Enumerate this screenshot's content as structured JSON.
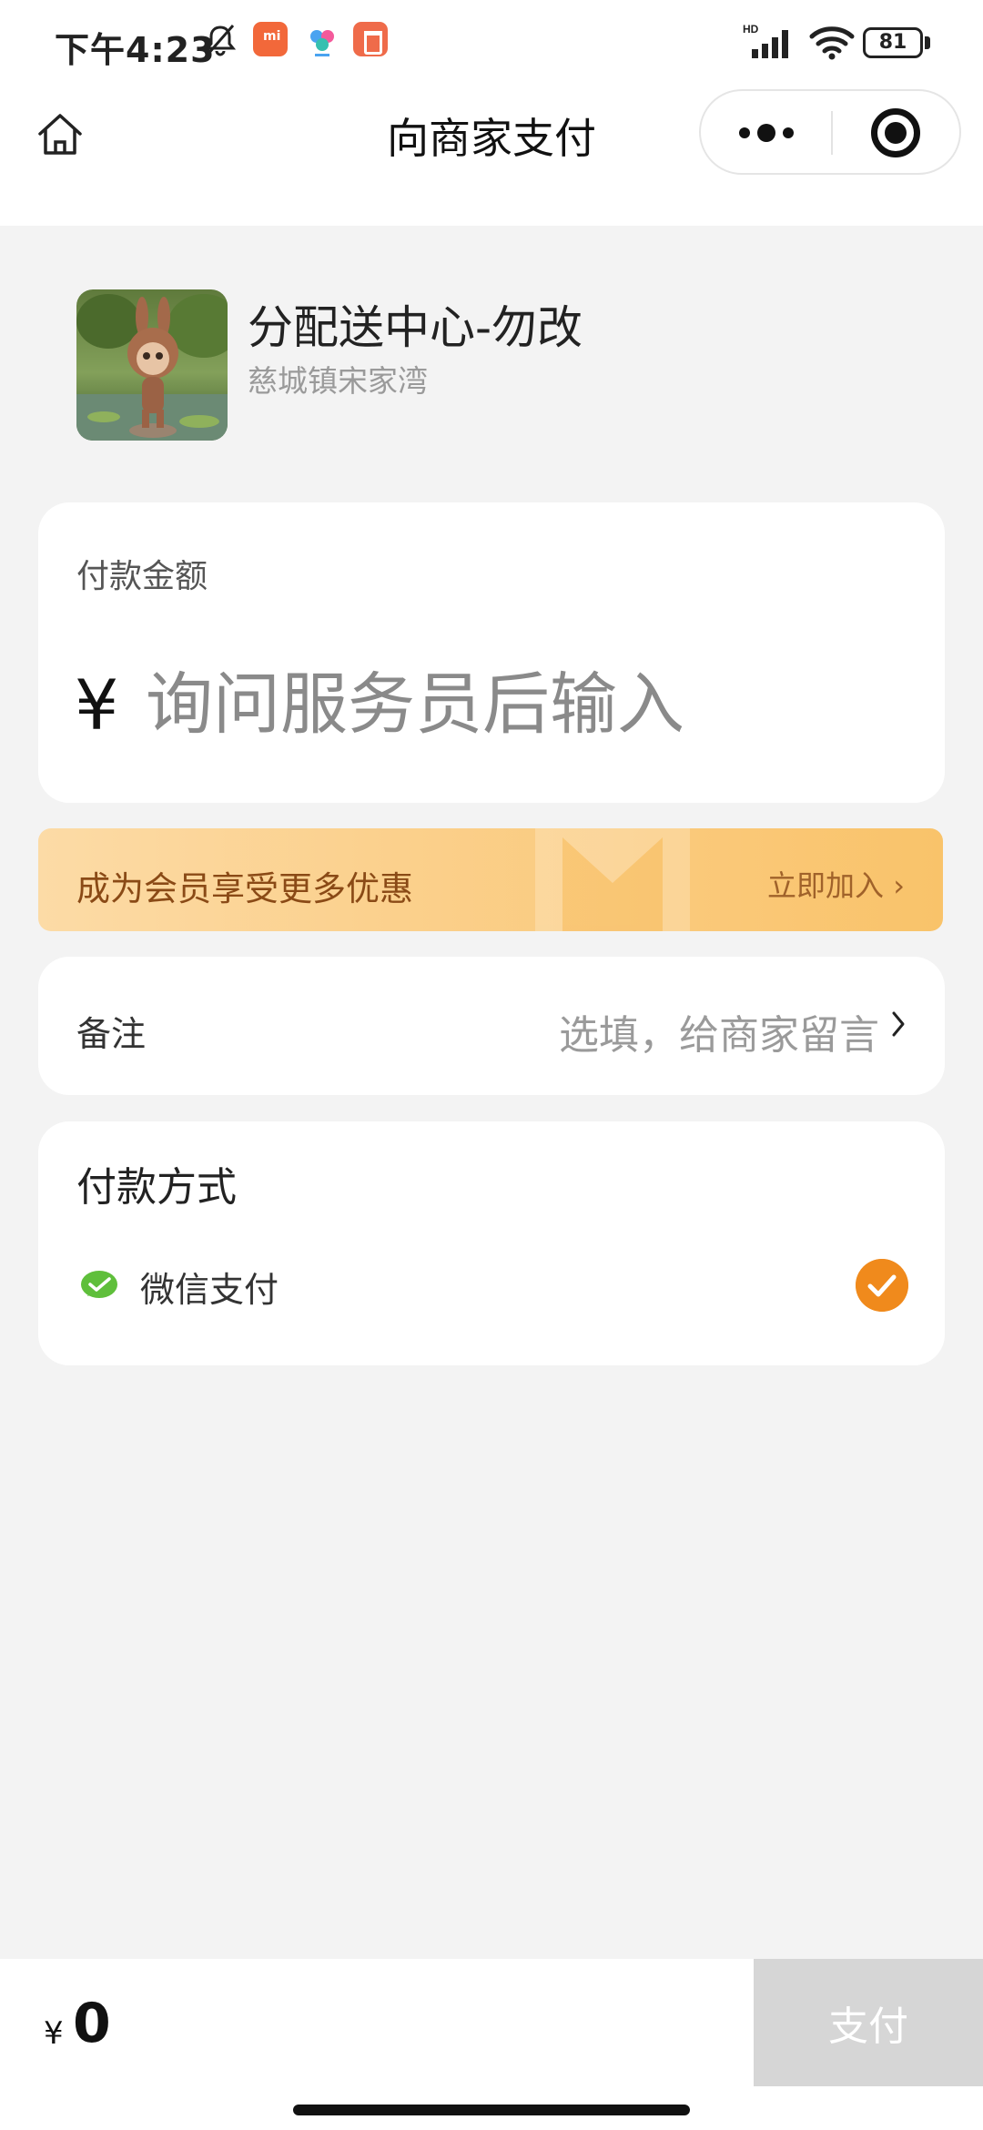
{
  "status_bar": {
    "time": "下午4:23",
    "battery": "81"
  },
  "nav": {
    "title": "向商家支付"
  },
  "merchant": {
    "name": "分配送中心-勿改",
    "address": "慈城镇宋家湾"
  },
  "amount": {
    "label": "付款金额",
    "currency": "¥",
    "placeholder": "询问服务员后输入"
  },
  "member_banner": {
    "text": "成为会员享受更多优惠",
    "join": "立即加入 ›"
  },
  "remark": {
    "label": "备注",
    "placeholder": "选填，给商家留言"
  },
  "payment": {
    "title": "付款方式",
    "method": "微信支付",
    "selected": true
  },
  "bottom": {
    "currency": "¥",
    "total": "0",
    "pay_label": "支付"
  },
  "colors": {
    "accent_orange": "#f08a1c",
    "pay_disabled": "#d6d6d6",
    "banner_text": "#8a4a16",
    "wechat_green": "#5fbf3b"
  },
  "icons": [
    "bell-mute-icon",
    "home-icon",
    "more-dots-icon",
    "close-mini-program-icon",
    "wechat-pay-icon",
    "check-icon",
    "chevron-right-icon"
  ]
}
